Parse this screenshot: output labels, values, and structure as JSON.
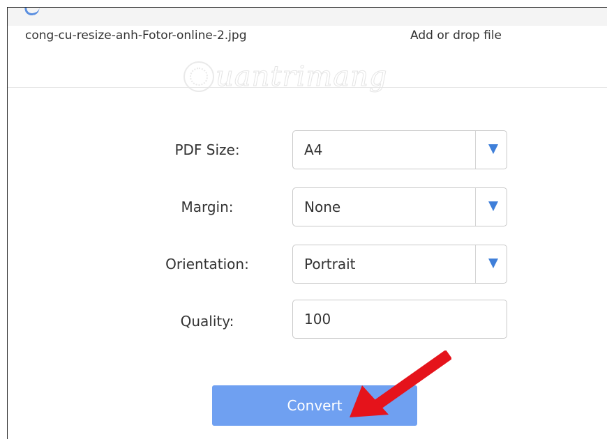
{
  "file": {
    "name": "cong-cu-resize-anh-Fotor-online-2.jpg",
    "add_drop_label": "Add or drop file"
  },
  "watermark": {
    "text": "uantrimang"
  },
  "options": {
    "pdf_size": {
      "label": "PDF Size:",
      "value": "A4"
    },
    "margin": {
      "label": "Margin:",
      "value": "None"
    },
    "orientation": {
      "label": "Orientation:",
      "value": "Portrait"
    },
    "quality": {
      "label": "Quality:",
      "value": "100"
    }
  },
  "convert_button": {
    "label": "Convert"
  },
  "colors": {
    "accent_blue": "#6fa0f1",
    "arrow_blue": "#3f7fd9",
    "annotation_red": "#e5131b"
  },
  "icons": {
    "dropdown": "triangle-down-icon",
    "annotation": "red-arrow-icon"
  }
}
